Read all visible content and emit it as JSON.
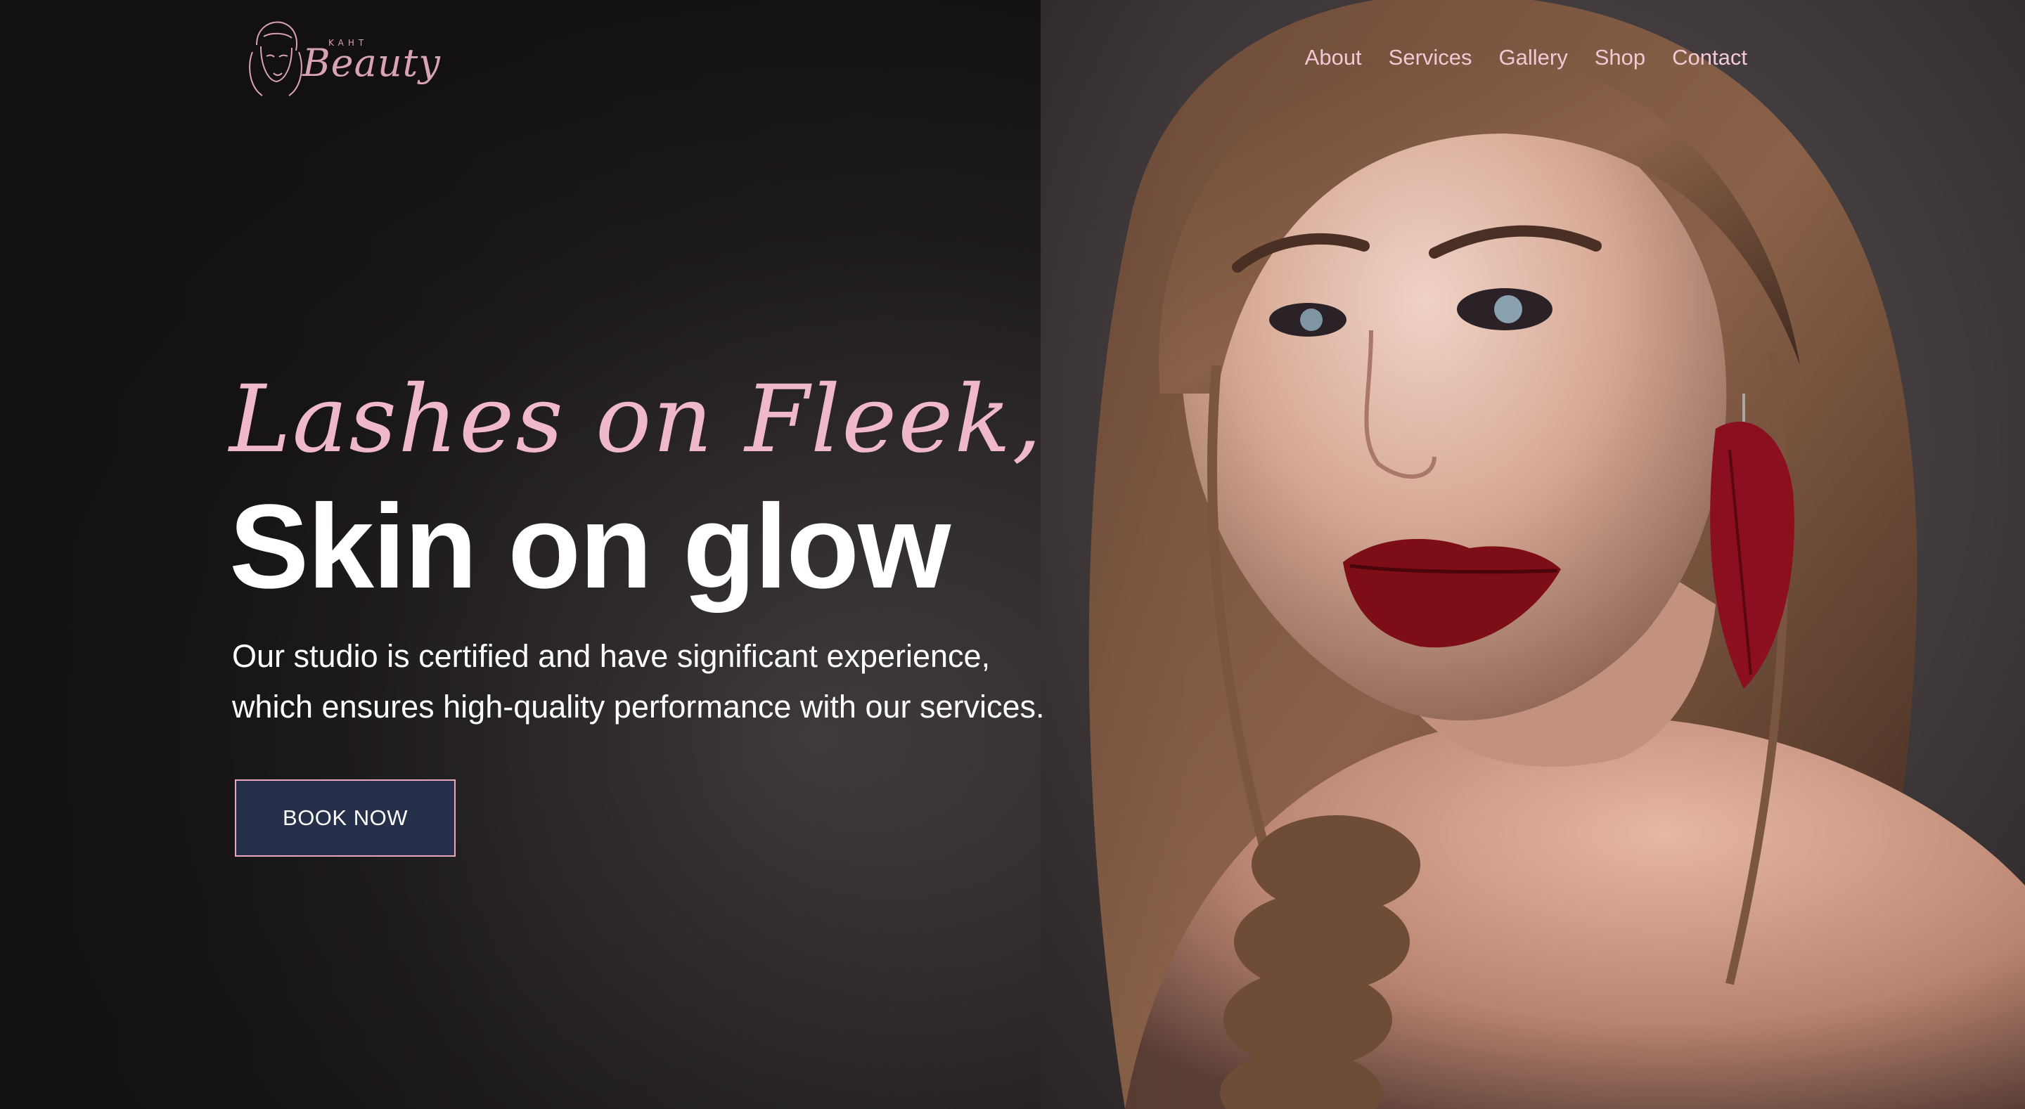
{
  "header": {
    "logo": {
      "small_text": "KAHT",
      "brand_text": "Beauty",
      "icon": "woman-face-line-art-icon"
    },
    "nav": [
      {
        "label": "About"
      },
      {
        "label": "Services"
      },
      {
        "label": "Gallery"
      },
      {
        "label": "Shop"
      },
      {
        "label": "Contact"
      }
    ]
  },
  "hero": {
    "script_line": "Lashes on Fleek,",
    "headline": "Skin on glow",
    "description_line1": "Our studio is certified and have significant experience,",
    "description_line2": "which ensures high-quality performance with our services.",
    "cta_label": "BOOK NOW",
    "photo": "woman-portrait-red-lips-image"
  },
  "colors": {
    "accent_pink": "#f0b9cb",
    "nav_pink": "#f2c8d4",
    "button_navy": "#27304a",
    "button_border": "#e9a8bb",
    "background_dark": "#131112"
  }
}
